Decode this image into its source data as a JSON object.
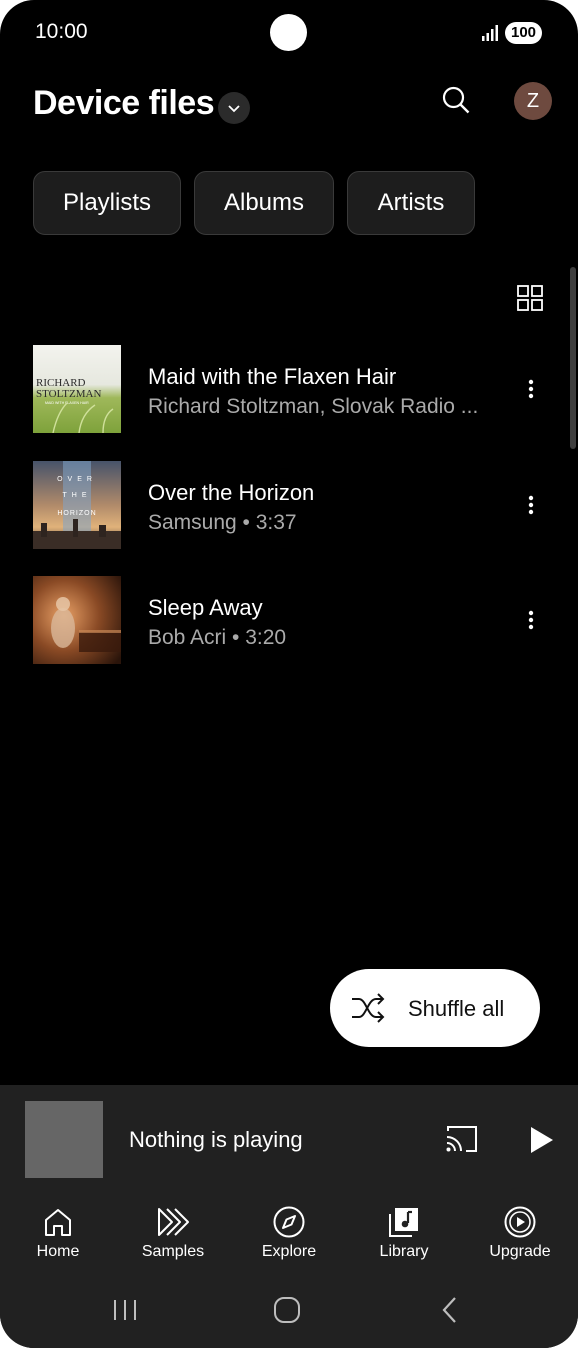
{
  "status_bar": {
    "time": "10:00",
    "battery": "100"
  },
  "header": {
    "title": "Device files",
    "avatar_letter": "Z"
  },
  "chips": [
    {
      "label": "Playlists"
    },
    {
      "label": "Albums"
    },
    {
      "label": "Artists"
    }
  ],
  "songs": [
    {
      "title": "Maid with the Flaxen Hair",
      "subtitle": "Richard Stoltzman, Slovak Radio ..."
    },
    {
      "title": "Over the Horizon",
      "subtitle": "Samsung • 3:37"
    },
    {
      "title": "Sleep Away",
      "subtitle": "Bob Acri • 3:20"
    }
  ],
  "album_art_text": {
    "richard_1": "RICHARD",
    "richard_2": "STOLTZMAN",
    "richard_3": "MAID WITH FLAXEN HAIR",
    "horizon_1": "OVER",
    "horizon_2": "THE",
    "horizon_3": "HORIZON"
  },
  "shuffle": {
    "label": "Shuffle all"
  },
  "mini_player": {
    "label": "Nothing is playing"
  },
  "bottom_nav": [
    {
      "label": "Home",
      "icon": "home-icon"
    },
    {
      "label": "Samples",
      "icon": "samples-icon"
    },
    {
      "label": "Explore",
      "icon": "compass-icon"
    },
    {
      "label": "Library",
      "icon": "library-icon"
    },
    {
      "label": "Upgrade",
      "icon": "upgrade-icon"
    }
  ],
  "system_nav": [
    "recents-icon",
    "home-circle-icon",
    "back-icon"
  ]
}
